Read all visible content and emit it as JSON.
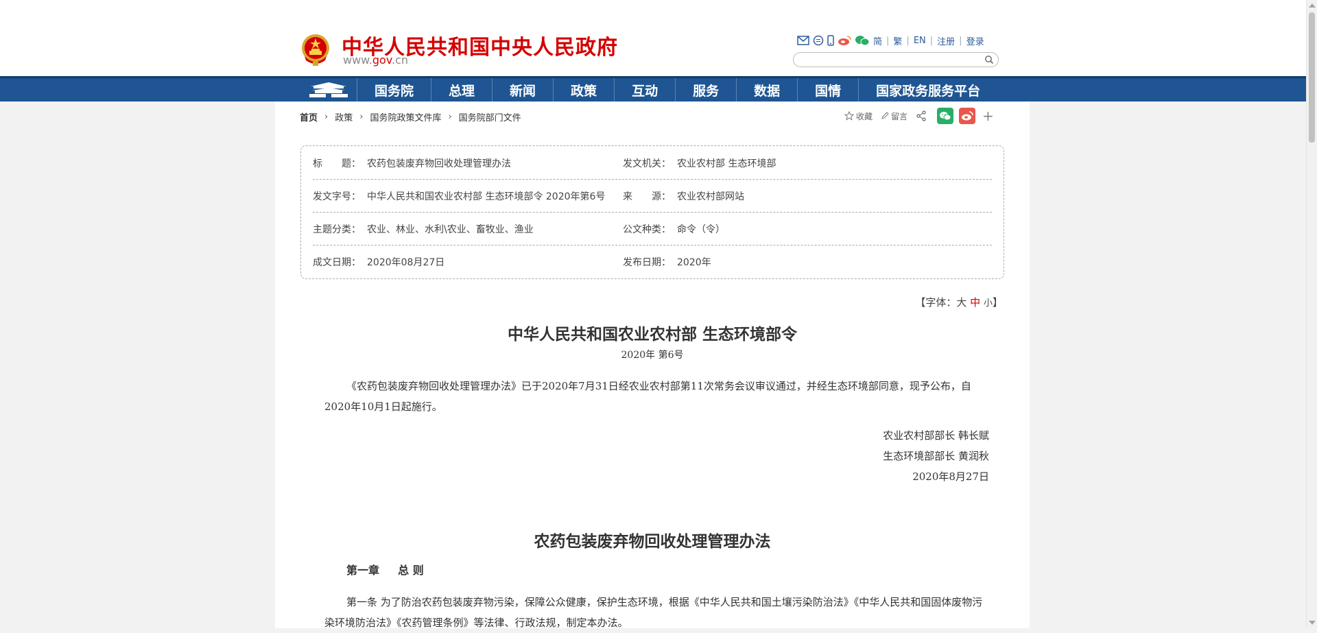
{
  "header": {
    "site_title": "中华人民共和国中央人民政府",
    "site_domain_prefix": "www.",
    "site_domain_mid": "gov",
    "site_domain_suffix": ".cn",
    "links": [
      "简",
      "繁",
      "EN",
      "注册",
      "登录"
    ],
    "icons": [
      "mail-icon",
      "message-icon",
      "mobile-icon",
      "weibo-icon",
      "wechat-icon"
    ],
    "search_placeholder": ""
  },
  "nav": {
    "items": [
      "国务院",
      "总理",
      "新闻",
      "政策",
      "互动",
      "服务",
      "数据",
      "国情",
      "国家政务服务平台"
    ]
  },
  "breadcrumb": [
    "首页",
    "政策",
    "国务院政策文件库",
    "国务院部门文件"
  ],
  "tools": {
    "favorite": "收藏",
    "comment": "留言"
  },
  "info": {
    "title_label": "标　　题：",
    "title_value": "农药包装废弃物回收处理管理办法",
    "issuer_label": "发文机关：",
    "issuer_value": "农业农村部 生态环境部",
    "doc_no_label": "发文字号：",
    "doc_no_value": "中华人民共和国农业农村部 生态环境部令 2020年第6号",
    "source_label": "来　　源：",
    "source_value": "农业农村部网站",
    "topic_label": "主题分类：",
    "topic_value": "农业、林业、水利\\农业、畜牧业、渔业",
    "type_label": "公文种类：",
    "type_value": "命令（令）",
    "date_label": "成文日期：",
    "date_value": "2020年08月27日",
    "pub_label": "发布日期：",
    "pub_value": "2020年"
  },
  "font_size": {
    "prefix": "【字体：",
    "large": "大",
    "medium": "中",
    "small": "小",
    "suffix": "】"
  },
  "article": {
    "decree_title": "中华人民共和国农业农村部 生态环境部令",
    "decree_no": "2020年 第6号",
    "intro": "《农药包装废弃物回收处理管理办法》已于2020年7月31日经农业农村部第11次常务会议审议通过，并经生态环境部同意，现予公布，自2020年10月1日起施行。",
    "sign1": "农业农村部部长 韩长赋",
    "sign2": "生态环境部部长 黄润秋",
    "sign_date": "2020年8月27日",
    "law_title": "农药包装废弃物回收处理管理办法",
    "chapter": "第一章　  总 则",
    "article1": "第一条 为了防治农药包装废弃物污染，保障公众健康，保护生态环境，根据《中华人民共和国土壤污染防治法》《中华人民共和国固体废物污染环境防治法》《农药管理条例》等法律、行政法规，制定本办法。"
  },
  "colors": {
    "brand_red": "#d40000",
    "nav_blue": "#1e5592",
    "wechat_green": "#2aae67",
    "weibo_red": "#e8574b"
  }
}
